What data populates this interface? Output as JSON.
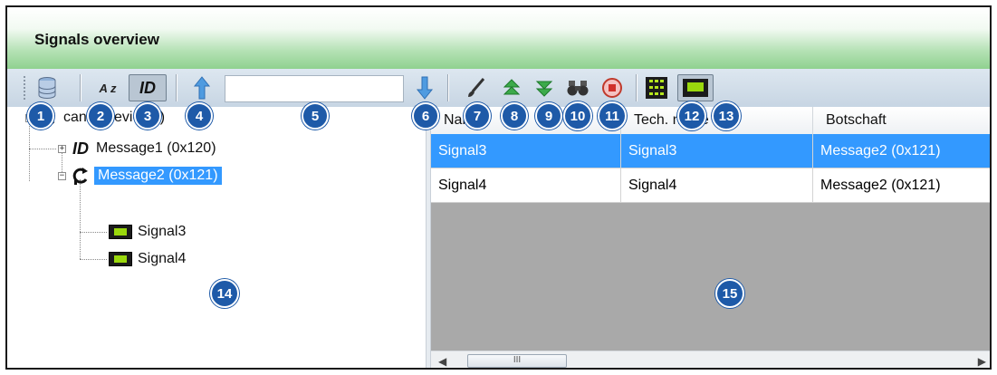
{
  "panel": {
    "title": "Signals overview"
  },
  "toolbar": {
    "icons": {
      "database": "database-icon",
      "sort_az": "sort-az-icon",
      "id_mode": "id-icon",
      "up": "arrow-up-icon",
      "down": "arrow-down-icon",
      "brush": "brush-icon",
      "expand": "expand-up-icon",
      "collapse": "collapse-down-icon",
      "find": "binoculars-icon",
      "stop": "stop-icon",
      "grid": "grid-icon",
      "signal": "signal-icon"
    },
    "sort_label": "A z",
    "id_label": "ID",
    "search_value": ""
  },
  "callouts": [
    "1",
    "2",
    "3",
    "4",
    "5",
    "6",
    "7",
    "8",
    "9",
    "10",
    "11",
    "12",
    "13",
    "14",
    "15"
  ],
  "tree": {
    "root": "can1 (Device 0)",
    "msg1_prefix": "ID",
    "msg1": "Message1 (0x120)",
    "msg2": "Message2 (0x121)",
    "sig3": "Signal3",
    "sig4": "Signal4"
  },
  "table": {
    "columns": [
      "Name",
      "Tech. name",
      "Botschaft"
    ],
    "rows": [
      [
        "Signal3",
        "Signal3",
        "Message2 (0x121)"
      ],
      [
        "Signal4",
        "Signal4",
        "Message2 (0x121)"
      ]
    ],
    "scroll_thumb": "III"
  },
  "colors": {
    "accent": "#3399ff",
    "callout": "#1e5aa8",
    "header": "#8fd18f"
  }
}
